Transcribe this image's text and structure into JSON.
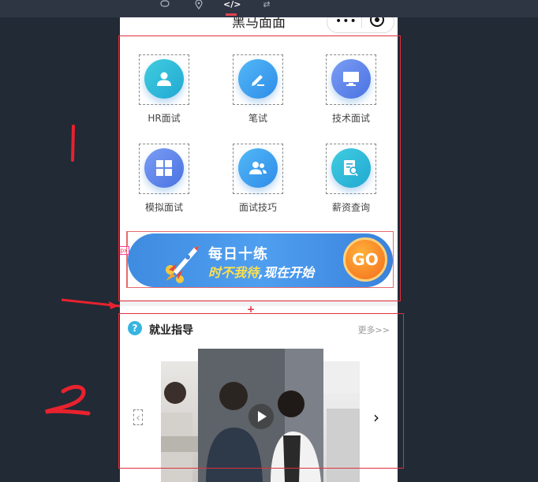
{
  "toolbar": {
    "icons": [
      "chat-icon",
      "location-icon",
      "code-icon",
      "shuffle-icon"
    ],
    "active": "code-icon"
  },
  "nav": {
    "title": "黑马面面",
    "capsule_more": "•••"
  },
  "grid": [
    {
      "label": "HR面试",
      "icon": "person-icon",
      "color": "#2bbbd8"
    },
    {
      "label": "笔试",
      "icon": "pencil-icon",
      "color": "#3d9cf0"
    },
    {
      "label": "技术面试",
      "icon": "monitor-icon",
      "color": "#5a86ec"
    },
    {
      "label": "模拟面试",
      "icon": "grid-icon",
      "color": "#5a86ec"
    },
    {
      "label": "面试技巧",
      "icon": "users-icon",
      "color": "#3d9cf0"
    },
    {
      "label": "薪资查询",
      "icon": "document-search-icon",
      "color": "#2bbbd8"
    }
  ],
  "banner": {
    "line1": "每日十练",
    "line2_highlight": "时不我待",
    "line2_rest": ",现在开始",
    "go": "GO",
    "spacing_tag": "8px"
  },
  "section": {
    "title": "就业指导",
    "more": "更多>>",
    "q_icon": "?"
  },
  "annotations": {
    "mark1": "1",
    "mark2": "2"
  },
  "colors": {
    "accent_red": "#e0303a",
    "banner_blue": "#4f9ff0",
    "go_orange": "#f46b1c"
  }
}
